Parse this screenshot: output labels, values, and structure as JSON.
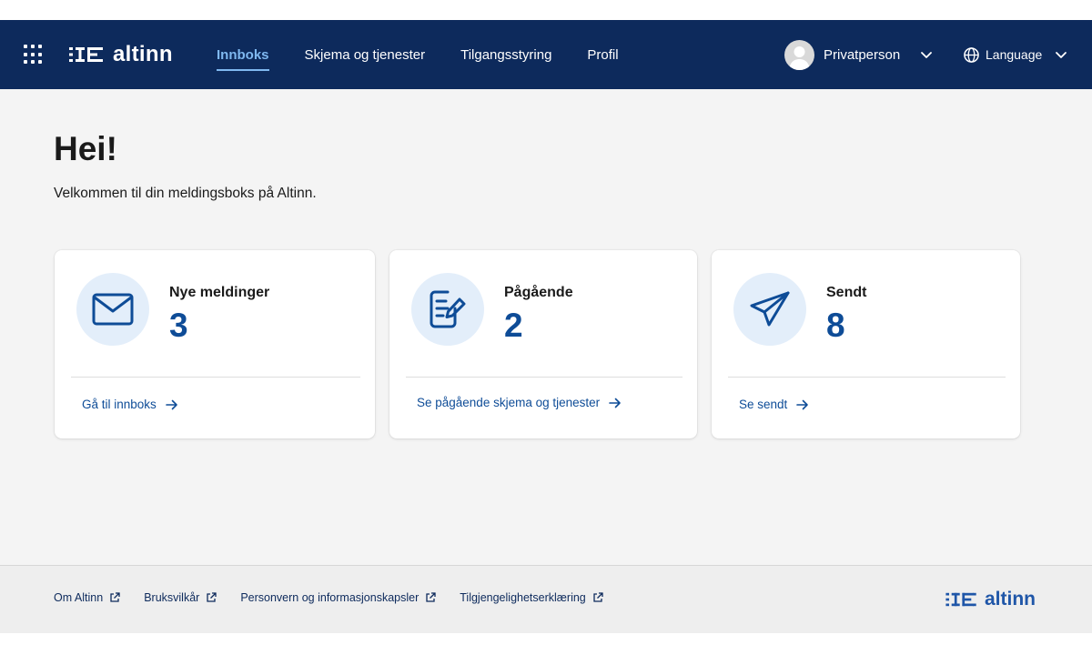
{
  "header": {
    "logo_text": "altinn",
    "nav": [
      {
        "label": "Innboks",
        "active": true
      },
      {
        "label": "Skjema og tjenester",
        "active": false
      },
      {
        "label": "Tilgangsstyring",
        "active": false
      },
      {
        "label": "Profil",
        "active": false
      }
    ],
    "user_name": "Privatperson",
    "language_label": "Language"
  },
  "main": {
    "greeting": "Hei!",
    "welcome": "Velkommen til din meldingsboks på Altinn.",
    "cards": [
      {
        "icon": "envelope-icon",
        "title": "Nye meldinger",
        "count": "3",
        "link": "Gå til innboks"
      },
      {
        "icon": "form-edit-icon",
        "title": "Pågående",
        "count": "2",
        "link": "Se pågående skjema og tjenester"
      },
      {
        "icon": "paper-plane-icon",
        "title": "Sendt",
        "count": "8",
        "link": "Se sendt"
      }
    ]
  },
  "footer": {
    "links": [
      "Om Altinn",
      "Bruksvilkår",
      "Personvern og informasjonskapsler",
      "Tilgjengelighetserklæring"
    ],
    "logo_text": "altinn"
  },
  "colors": {
    "header_bg": "#0d2a5c",
    "nav_active": "#7fb8f0",
    "accent": "#0e4c97",
    "icon_circle": "#e3eefa",
    "page_bg": "#f4f4f4"
  }
}
